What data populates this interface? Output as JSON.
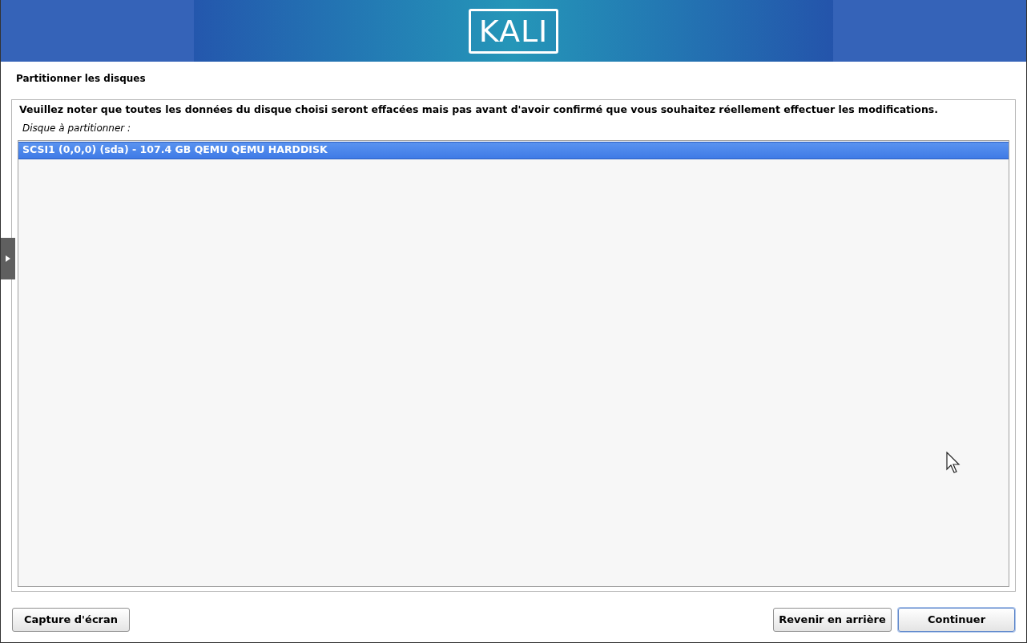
{
  "banner": {
    "logo": "KALI"
  },
  "page_title": "Partitionner les disques",
  "notice": "Veuillez noter que toutes les données du disque choisi seront effacées mais pas avant d'avoir confirmé que vous souhaitez réellement effectuer les modifications.",
  "list_label": "Disque à partitionner :",
  "disks": [
    {
      "label": "SCSI1 (0,0,0) (sda) - 107.4 GB QEMU QEMU HARDDISK",
      "selected": true
    }
  ],
  "buttons_left": [
    {
      "label": "Capture d'écran",
      "focused": false
    }
  ],
  "buttons_right": [
    {
      "label": "Revenir en arrière",
      "focused": false
    },
    {
      "label": "Continuer",
      "focused": true
    }
  ]
}
